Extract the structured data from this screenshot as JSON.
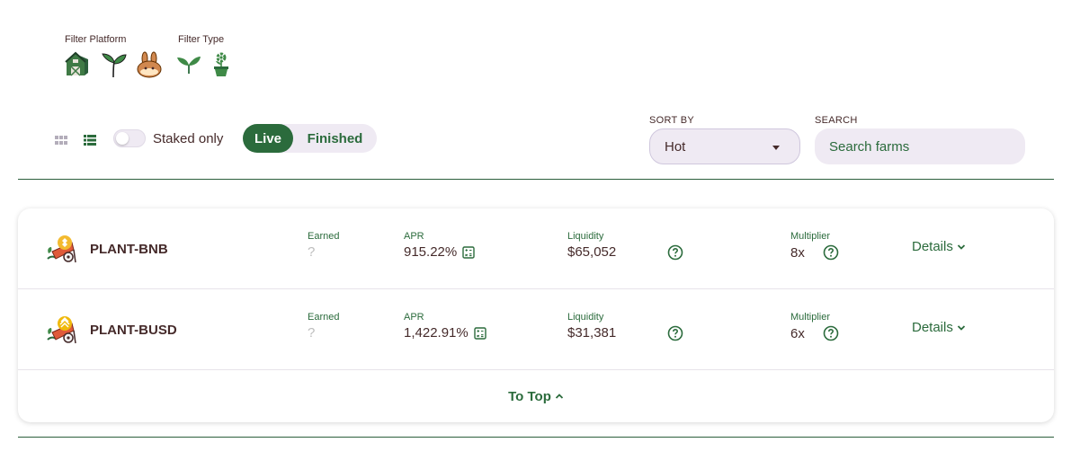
{
  "filters": {
    "platform_title": "Filter Platform",
    "platform_icons": [
      "barn-icon",
      "sprout-icon",
      "pancake-bunny-icon"
    ],
    "type_title": "Filter Type",
    "type_icons": [
      "leaf-icon",
      "flower-pot-icon"
    ]
  },
  "toolbar": {
    "staked_only_label": "Staked only",
    "staked_only": false,
    "tabs": [
      {
        "label": "Live",
        "active": true
      },
      {
        "label": "Finished",
        "active": false
      }
    ],
    "sort_label": "SORT BY",
    "sort_value": "Hot",
    "search_label": "SEARCH",
    "search_placeholder": "Search farms"
  },
  "columns": {
    "earned": "Earned",
    "apr": "APR",
    "liquidity": "Liquidity",
    "multiplier": "Multiplier"
  },
  "farms": [
    {
      "name": "PLANT-BNB",
      "earned": "?",
      "apr": "915.22%",
      "liquidity": "$65,052",
      "multiplier": "8x",
      "details_label": "Details"
    },
    {
      "name": "PLANT-BUSD",
      "earned": "?",
      "apr": "1,422.91%",
      "liquidity": "$31,381",
      "multiplier": "6x",
      "details_label": "Details"
    }
  ],
  "to_top_label": "To Top",
  "colors": {
    "primary_green": "#2b6b3c",
    "text_brown": "#452a2a",
    "input_bg": "#efeaf3"
  }
}
